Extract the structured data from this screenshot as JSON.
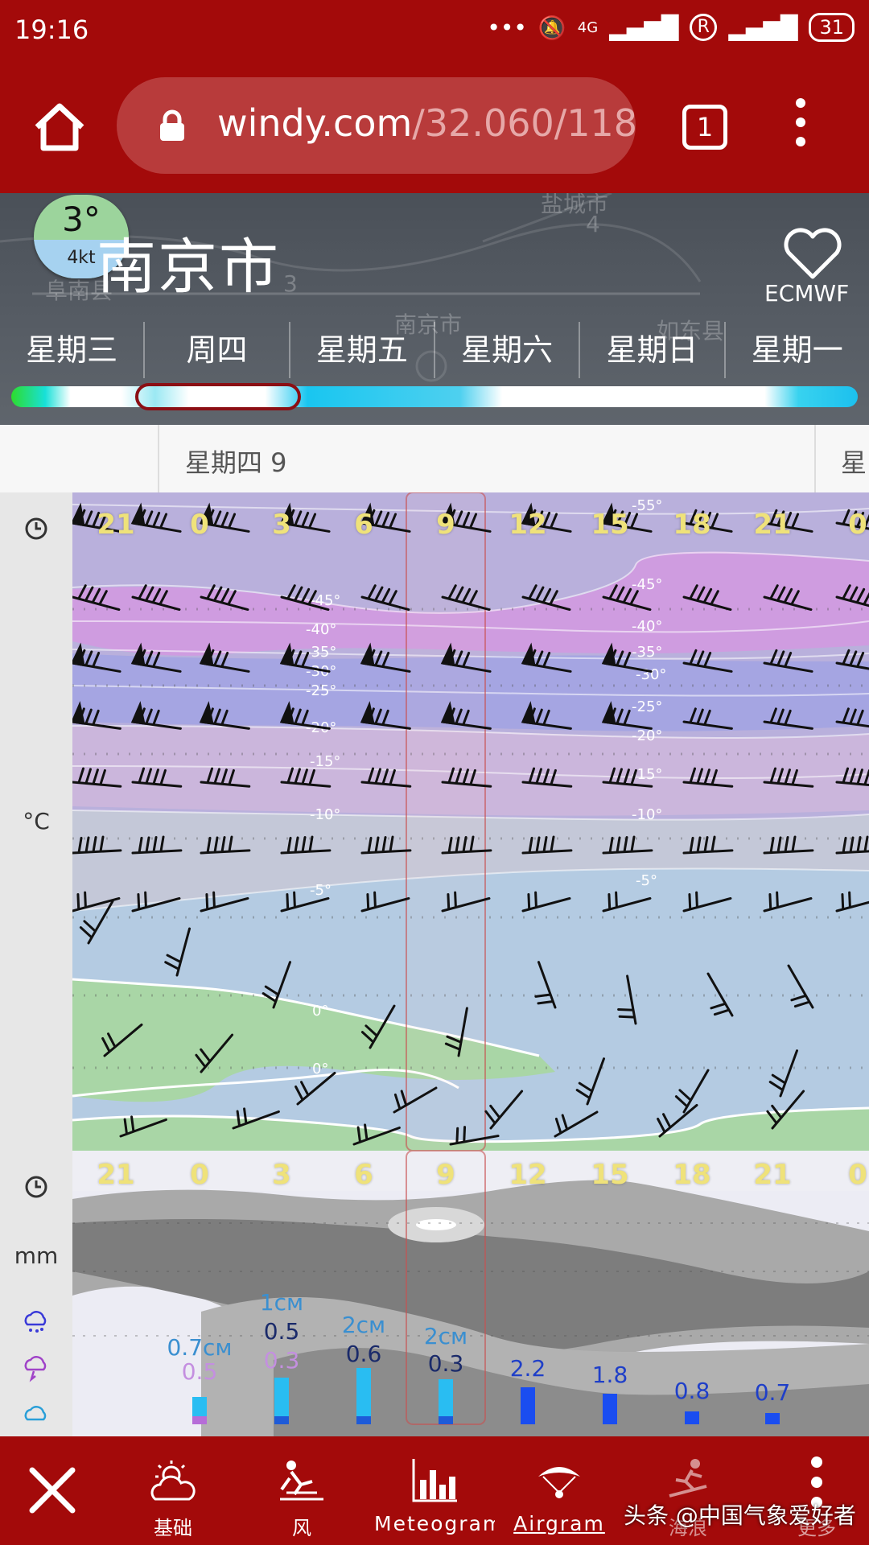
{
  "status": {
    "time": "19:16",
    "network": "4G",
    "roaming": "R",
    "battery": "31"
  },
  "browser": {
    "url_main": "windy.com",
    "url_rest": "/32.060/118",
    "tab_count": "1"
  },
  "header": {
    "temperature": "3°",
    "wind": "4kt",
    "city": "南京市",
    "model": "ECMWF",
    "map_labels": [
      "盐城市",
      "4",
      "阜南县",
      "3",
      "南京市",
      "如东县"
    ]
  },
  "days": [
    "星期三",
    "周四",
    "星期五",
    "星期六",
    "星期日",
    "星期一"
  ],
  "date_header": {
    "label": "星期四 9",
    "next": "星"
  },
  "left_labels": {
    "unit_temp": "°C",
    "unit_precip": "mm"
  },
  "hours": [
    "21",
    "0",
    "3",
    "6",
    "9",
    "12",
    "15",
    "18",
    "21",
    "0"
  ],
  "isotherms": [
    "-55°",
    "-45°",
    "-40°",
    "-35°",
    "-30°",
    "-25°",
    "-20°",
    "-15°",
    "-10°",
    "-5°",
    "0°"
  ],
  "precip": {
    "snow_labels": [
      "0.7cм",
      "1cм",
      "2cм",
      "2cм"
    ],
    "rain_labels": [
      "0.5",
      "0.5",
      "0.6",
      "0.3",
      "2.2",
      "1.8",
      "0.8",
      "0.7"
    ],
    "other_labels": [
      "0.5",
      "0.3"
    ]
  },
  "bottom_nav": {
    "close_icon": "close-icon",
    "items": [
      "基础",
      "风",
      "Meteogram",
      "Airgram",
      "海浪",
      "更多"
    ]
  },
  "watermark": "头条 @中国气象爱好者",
  "colors": {
    "brand": "#a30a0a",
    "hour_labels": "#efe27a",
    "selection": "#8b0f14"
  }
}
